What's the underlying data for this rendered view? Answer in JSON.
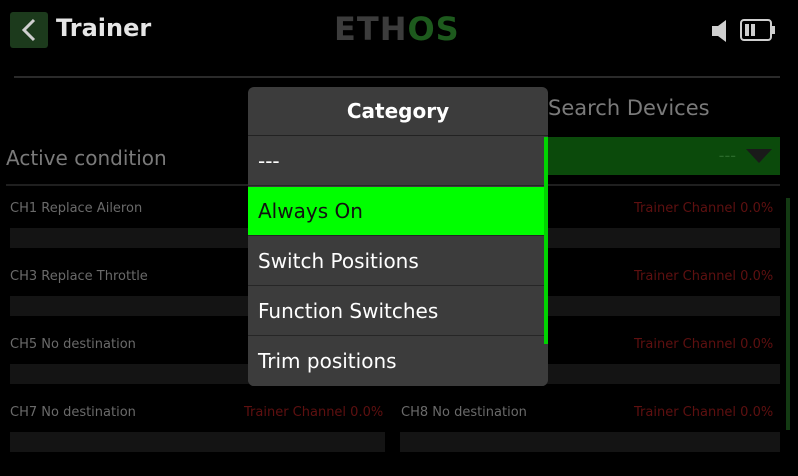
{
  "header": {
    "title": "Trainer",
    "logo_main": "ETH",
    "logo_accent": "OS"
  },
  "background": {
    "active_condition_label": "Active condition",
    "search_devices_label": "Search Devices",
    "dropdown_value": "---",
    "channels_left": [
      {
        "label": "CH1 Replace Aileron"
      },
      {
        "label": "CH3 Replace Throttle"
      },
      {
        "label": "CH5 No destination"
      },
      {
        "label": "CH7 No destination",
        "value": "Trainer Channel 0.0%"
      }
    ],
    "channels_right": [
      {
        "value": "Trainer Channel 0.0%"
      },
      {
        "value": "Trainer Channel 0.0%"
      },
      {
        "value": "Trainer Channel 0.0%"
      },
      {
        "label": "CH8 No destination",
        "value": "Trainer Channel 0.0%"
      }
    ]
  },
  "modal": {
    "title": "Category",
    "options": [
      "---",
      "Always On",
      "Switch Positions",
      "Function Switches",
      "Trim positions"
    ],
    "selected_index": 1
  },
  "colors": {
    "accent": "#00ff00",
    "modal_bg": "#3c3c3c",
    "background": "#000000"
  }
}
